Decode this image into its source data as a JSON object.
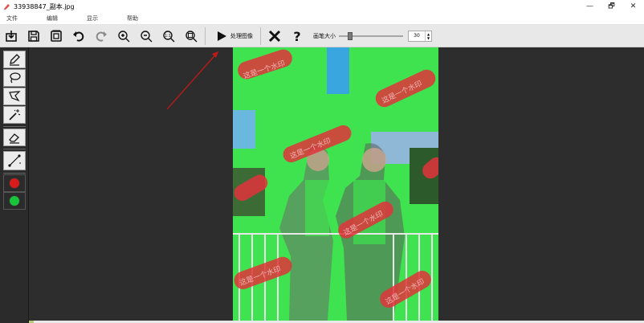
{
  "window": {
    "title": "33938847_副本.jpg",
    "minimize": "—",
    "maximize": "🗗",
    "close": "✕"
  },
  "menu": [
    "文件",
    "编辑",
    "显示",
    "帮助"
  ],
  "toolbar": {
    "process_label": "处理图像",
    "brush_label": "画笔大小",
    "brush_value": "30",
    "brush_fraction": 0.15
  },
  "tools": {
    "color_red": "#d81b1b",
    "color_green": "#19c43a"
  },
  "image": {
    "mask_color": "#3fe34f",
    "stroke_color": "#e2333b",
    "watermark_text": "这是一个水印"
  },
  "icons": [
    "import-icon",
    "save-icon",
    "save-as-icon",
    "undo-icon",
    "redo-icon",
    "zoom-in-icon",
    "zoom-out-icon",
    "zoom-actual-icon",
    "zoom-fit-icon",
    "play-icon",
    "cancel-x-icon",
    "help-question-icon"
  ]
}
